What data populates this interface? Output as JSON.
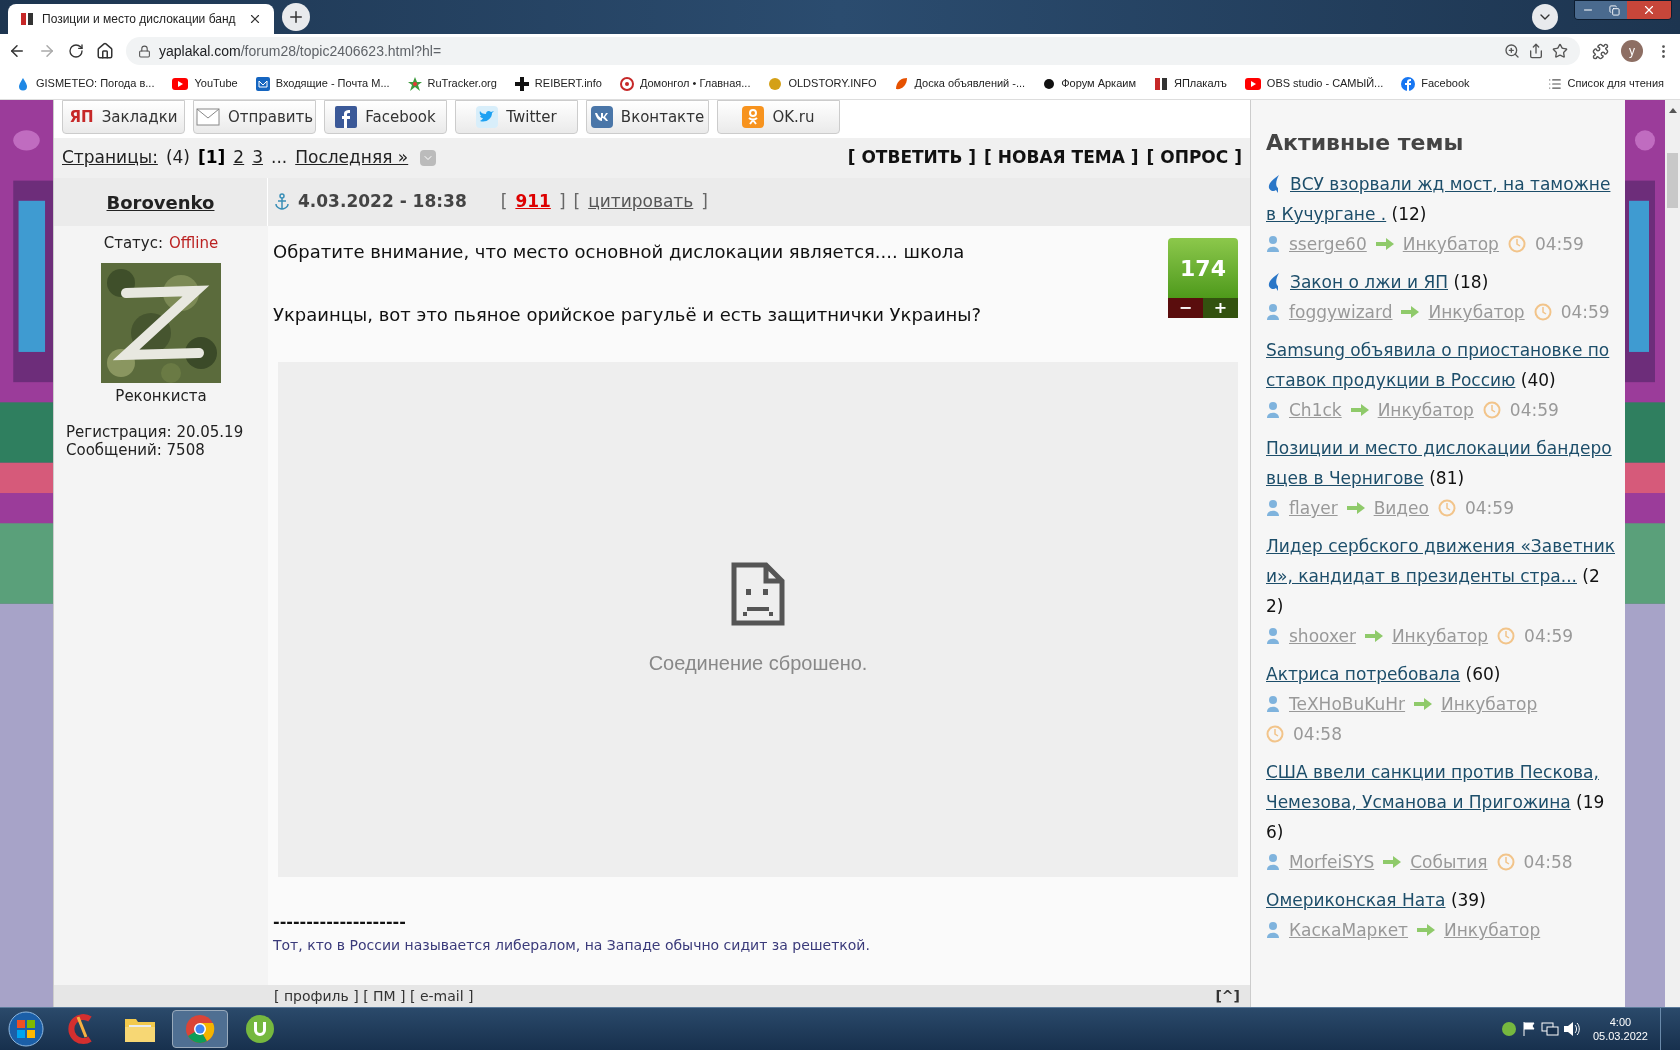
{
  "browser": {
    "tab_title": "Позиции и место дислокации банд",
    "url_host": "yaplakal.com",
    "url_path": "/forum28/topic2406623.html?hl=",
    "profile_initial": "у",
    "bookmarks": [
      {
        "kind": "drop",
        "label": "GISMETEO: Погода в..."
      },
      {
        "kind": "youtube",
        "label": "YouTube"
      },
      {
        "kind": "mail",
        "label": "Входящие - Почта М..."
      },
      {
        "kind": "star",
        "label": "RuTracker.org"
      },
      {
        "kind": "cross",
        "label": "REIBERT.info"
      },
      {
        "kind": "target",
        "label": "Домонгол • Главная..."
      },
      {
        "kind": "bee",
        "label": "OLDSTORY.INFO"
      },
      {
        "kind": "leaf",
        "label": "Доска объявлений -..."
      },
      {
        "kind": "dot",
        "label": "Форум Аркаим"
      },
      {
        "kind": "yap",
        "label": "ЯПлакалъ"
      },
      {
        "kind": "youtube",
        "label": "OBS studio - САМЫЙ..."
      },
      {
        "kind": "facebook",
        "label": "Facebook"
      }
    ],
    "reading_list": "Список для чтения"
  },
  "share_buttons": [
    {
      "kind": "yap",
      "logo": "ЯП",
      "label": "Закладки"
    },
    {
      "kind": "mail",
      "label": "Отправить"
    },
    {
      "kind": "facebook",
      "label": "Facebook"
    },
    {
      "kind": "twitter",
      "label": "Twitter"
    },
    {
      "kind": "vk",
      "label": "Вконтакте"
    },
    {
      "kind": "ok",
      "label": "OK.ru"
    }
  ],
  "pagination": {
    "label": "Страницы:",
    "count": "(4)",
    "pages": [
      {
        "label": "[1]",
        "selected": true
      },
      {
        "label": "2",
        "selected": false
      },
      {
        "label": "3",
        "selected": false
      }
    ],
    "ellipsis": "...",
    "last": "Последняя »",
    "actions": [
      "[ ОТВЕТИТЬ ]",
      "[ НОВАЯ ТЕМА ]",
      "[ ОПРОС ]"
    ]
  },
  "post": {
    "author": "Borovenko",
    "date": "4.03.2022 - 18:38",
    "meta": [
      {
        "kind": "bracket",
        "text": "["
      },
      {
        "kind": "number",
        "text": "911"
      },
      {
        "kind": "bracket",
        "text": "]"
      },
      {
        "kind": "bracket",
        "text": "["
      },
      {
        "kind": "quote",
        "text": "цитировать"
      },
      {
        "kind": "bracket",
        "text": "]"
      }
    ],
    "status_label": "Статус:",
    "status": "Offline",
    "rank": "Реконкиста",
    "registration": "Регистрация: 20.05.19",
    "messages": "Сообщений: 7508",
    "paragraphs": [
      "Обратите внимание, что место основной дислокации является.... школа",
      "Украинцы, вот это пьяное орийское рагульё и есть защитнички Украины?"
    ],
    "rating": "174",
    "minus": "−",
    "plus": "+",
    "embed_error": "Соединение сброшено.",
    "signature_rule": "--------------------",
    "signature": "Тот, кто в России называется либералом, на Западе обычно сидит за решеткой.",
    "footer_links": "[ профиль ] [ ПМ ] [ e-mail ]",
    "to_top": "[^]"
  },
  "sidebar": {
    "title": "Активные темы",
    "topics": [
      {
        "marked": true,
        "title": "ВСУ взорвали жд мост, на таможне в Кучургане .",
        "count": "(12)",
        "author": "sserge60",
        "section": "Инкубатор",
        "time": "04:59"
      },
      {
        "marked": true,
        "title": "Закон о лжи и ЯП",
        "count": "(18)",
        "author": "foggywizard",
        "section": "Инкубатор",
        "time": "04:59"
      },
      {
        "marked": false,
        "title": "Samsung объявила о приостановке поставок продукции в Россию",
        "count": "(40)",
        "author": "Ch1ck",
        "section": "Инкубатор",
        "time": "04:59"
      },
      {
        "marked": false,
        "title": "Позиции и место дислокации бандеровцев в Чернигове",
        "count": "(81)",
        "author": "flayer",
        "section": "Видео",
        "time": "04:59"
      },
      {
        "marked": false,
        "title": "Лидер сербского движения «Заветники», кандидат в президенты стра...",
        "count": "(22)",
        "author": "shooxer",
        "section": "Инкубатор",
        "time": "04:59"
      },
      {
        "marked": false,
        "title": "Актриса потребовала",
        "count": "(60)",
        "author": "TeXHoBuKuHr",
        "section": "Инкубатор",
        "time": "04:58"
      },
      {
        "marked": false,
        "title": "США ввели санкции против Пескова, Чемезова, Усманова и Пригожина",
        "count": "(196)",
        "author": "MorfeiSYS",
        "section": "События",
        "time": "04:58"
      },
      {
        "marked": false,
        "title": "Омериконская Ната",
        "count": "(39)",
        "author": "КаскаМаркет",
        "section": "Инкубатор"
      }
    ]
  },
  "taskbar": {
    "apps": [
      {
        "kind": "cleaner",
        "selected": false
      },
      {
        "kind": "folder",
        "selected": false
      },
      {
        "kind": "chrome",
        "selected": true
      },
      {
        "kind": "torrent",
        "selected": false
      }
    ],
    "time": "4:00",
    "date": "05.03.2022"
  }
}
